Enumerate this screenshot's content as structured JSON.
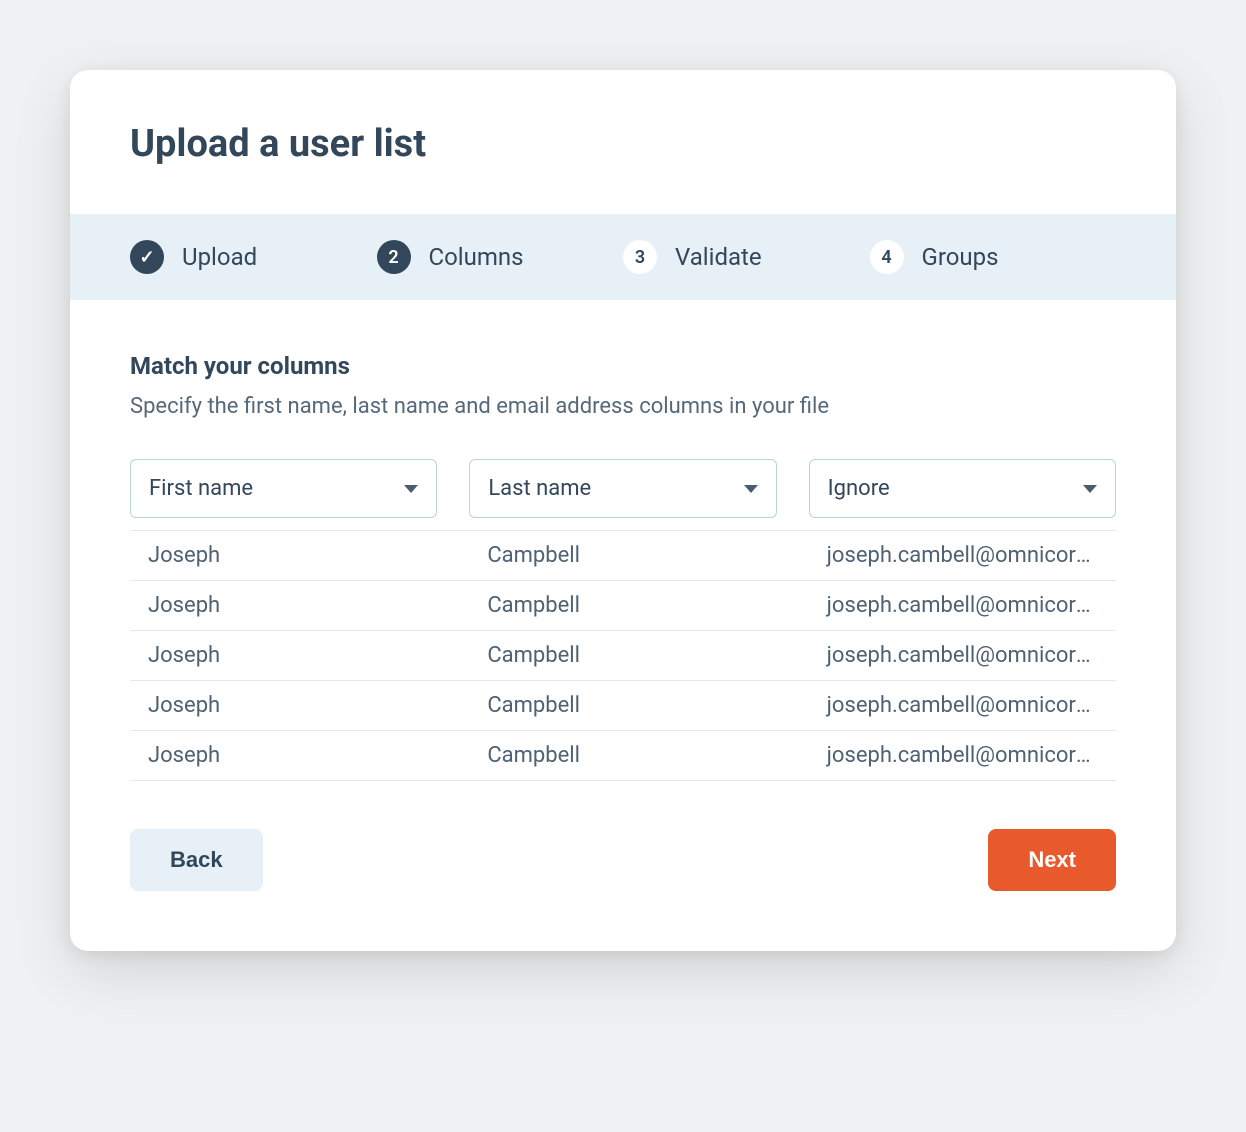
{
  "header": {
    "title": "Upload a user list"
  },
  "stepper": {
    "steps": [
      {
        "badge": "✓",
        "label": "Upload",
        "state": "done"
      },
      {
        "badge": "2",
        "label": "Columns",
        "state": "active"
      },
      {
        "badge": "3",
        "label": "Validate",
        "state": "pending"
      },
      {
        "badge": "4",
        "label": "Groups",
        "state": "pending"
      }
    ]
  },
  "section": {
    "title": "Match your columns",
    "description": "Specify the first name, last name and email address columns in your file"
  },
  "selects": [
    {
      "value": "First name"
    },
    {
      "value": "Last name"
    },
    {
      "value": "Ignore"
    }
  ],
  "rows": [
    {
      "c0": "Joseph",
      "c1": "Campbell",
      "c2": "joseph.cambell@omnicorp.com"
    },
    {
      "c0": "Joseph",
      "c1": "Campbell",
      "c2": "joseph.cambell@omnicorp.com"
    },
    {
      "c0": "Joseph",
      "c1": "Campbell",
      "c2": "joseph.cambell@omnicorp.com"
    },
    {
      "c0": "Joseph",
      "c1": "Campbell",
      "c2": "joseph.cambell@omnicorp.com"
    },
    {
      "c0": "Joseph",
      "c1": "Campbell",
      "c2": "joseph.cambell@omnicorp.com"
    }
  ],
  "footer": {
    "back": "Back",
    "next": "Next"
  }
}
